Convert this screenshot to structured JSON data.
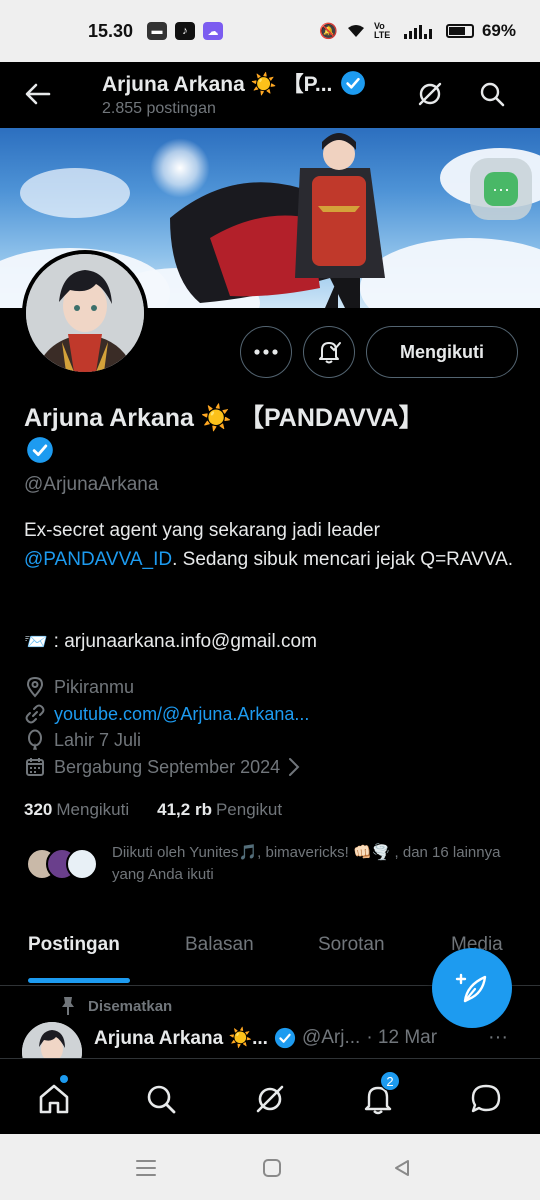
{
  "status_bar": {
    "time": "15.30",
    "battery_percent": "69%",
    "battery_level": 0.69,
    "network_label": "Vo LTE"
  },
  "header": {
    "title": "Arjuna Arkana ☀️ 【P...",
    "subtitle": "2.855 postingan"
  },
  "profile": {
    "name": "Arjuna Arkana ☀️ 【PANDAVVA】",
    "handle": "@ArjunaArkana",
    "bio_before": "Ex-secret agent yang sekarang jadi leader ",
    "bio_mention": "@PANDAVVA_ID",
    "bio_after": ". Sedang sibuk mencari jejak Q=RAVVA.",
    "email_emoji": "📨",
    "email": ": arjunaarkana.info@gmail.com",
    "location": "Pikiranmu",
    "website": "youtube.com/@Arjuna.Arkana...",
    "birthday": "Lahir 7 Juli",
    "joined": "Bergabung September 2024",
    "following_count": "320",
    "following_label": "Mengikuti",
    "followers_count": "41,2 rb",
    "followers_label": "Pengikut",
    "followed_by": "Diikuti oleh Yunites🎵, bimavericks! 👊🏻🌪️ , dan 16 lainnya yang Anda ikuti"
  },
  "actions": {
    "follow_label": "Mengikuti",
    "more_icon": "more-icon",
    "notify_icon": "bell-check-icon"
  },
  "tabs": [
    {
      "label": "Postingan",
      "active": true
    },
    {
      "label": "Balasan",
      "active": false
    },
    {
      "label": "Sorotan",
      "active": false
    },
    {
      "label": "Media",
      "active": false
    }
  ],
  "pinned_post": {
    "pinned_label": "Disematkan",
    "name": "Arjuna Arkana ☀️...",
    "handle": "@Arj...",
    "date": "· 12 Mar",
    "more": "···"
  },
  "bottom_nav": {
    "notification_badge": "2",
    "items": [
      "home-icon",
      "search-icon",
      "grok-icon",
      "bell-icon",
      "messages-icon"
    ]
  },
  "colors": {
    "accent": "#1d9bf0",
    "background": "#000000",
    "text": "#e7e9ea",
    "muted": "#71767b"
  }
}
